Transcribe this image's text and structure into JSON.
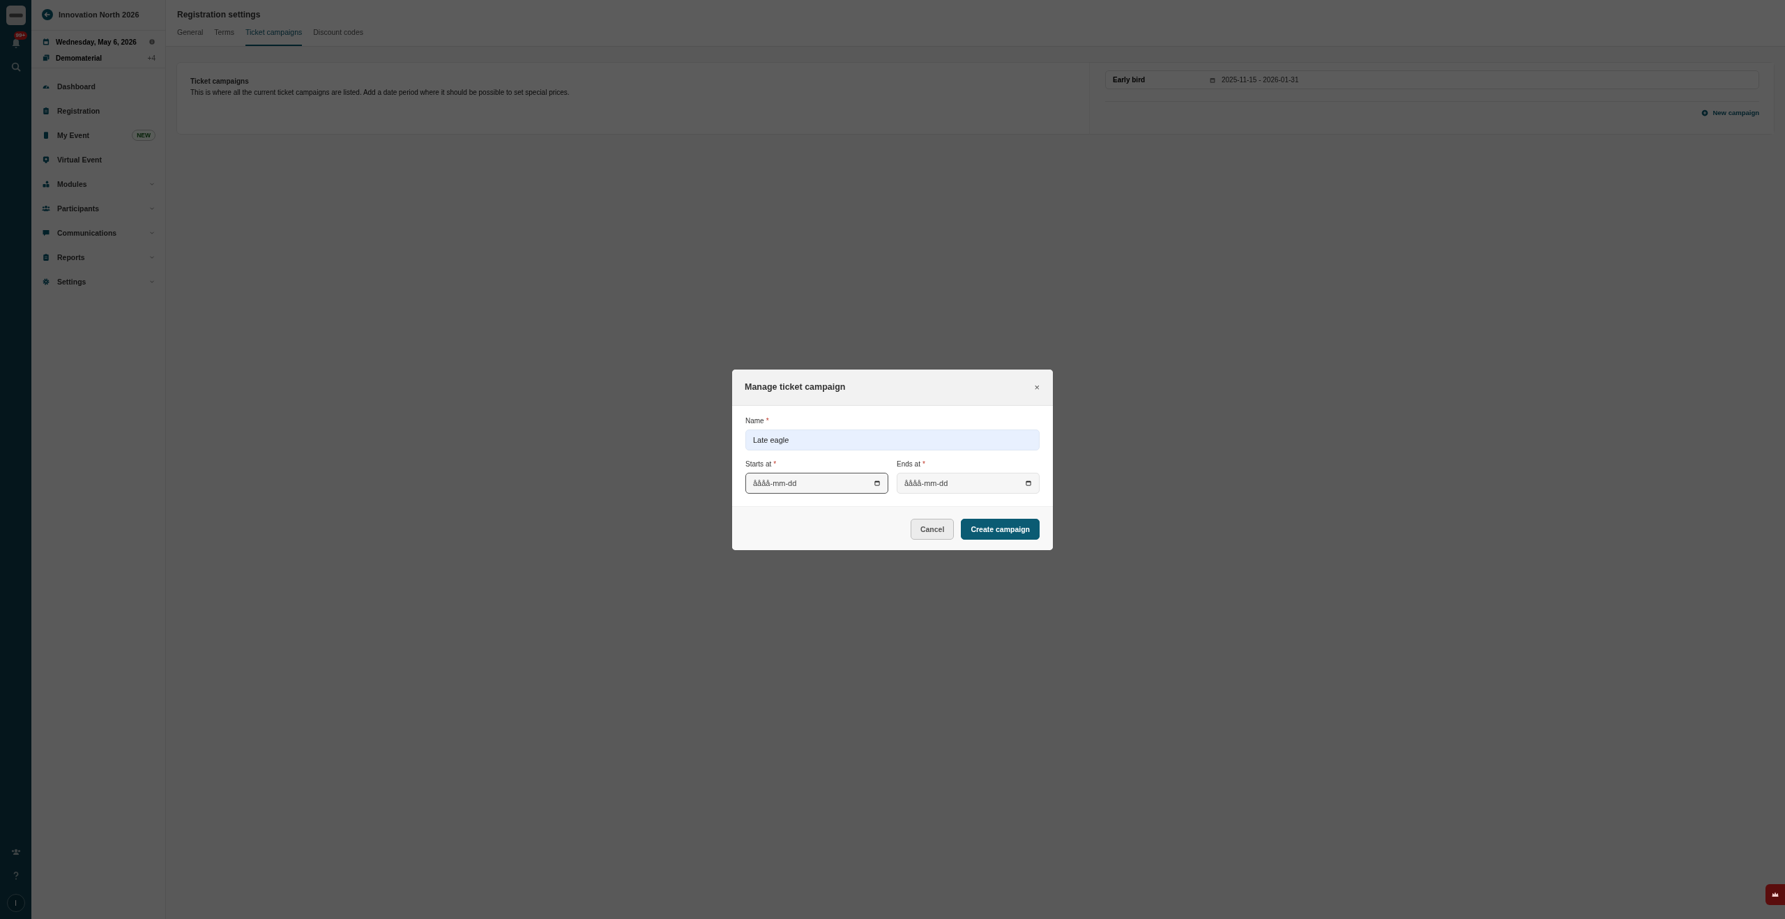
{
  "rail": {
    "notification_badge": "99+",
    "avatar_initial": "I"
  },
  "sidebar": {
    "event_title": "Innovation North 2026",
    "date": "Wednesday, May 6, 2026",
    "material": "Demomaterial",
    "material_count": "+4",
    "items": [
      {
        "label": "Dashboard",
        "kind": "link"
      },
      {
        "label": "Registration",
        "kind": "link"
      },
      {
        "label": "My Event",
        "kind": "link",
        "badge": "NEW"
      },
      {
        "label": "Virtual Event",
        "kind": "link"
      },
      {
        "label": "Modules",
        "kind": "group",
        "expanded": false
      },
      {
        "label": "Participants",
        "kind": "group",
        "expanded": false
      },
      {
        "label": "Communications",
        "kind": "group",
        "expanded": false
      },
      {
        "label": "Reports",
        "kind": "group",
        "expanded": false
      },
      {
        "label": "Settings",
        "kind": "group",
        "expanded": false
      }
    ]
  },
  "page": {
    "title": "Registration settings",
    "tabs": [
      {
        "label": "General",
        "selected": false
      },
      {
        "label": "Terms",
        "selected": false
      },
      {
        "label": "Ticket campaigns",
        "selected": true
      },
      {
        "label": "Discount codes",
        "selected": false
      }
    ]
  },
  "campaigns_section": {
    "title": "Ticket campaigns",
    "description": "This is where all the current ticket campaigns are listed. Add a date period where it should be possible to set special prices."
  },
  "campaigns": [
    {
      "name": "Early bird",
      "dates": "2025-11-15 - 2026-01-31"
    }
  ],
  "new_campaign_button": "New campaign",
  "dialog": {
    "title": "Manage ticket campaign",
    "close": "×",
    "required_mark": "*",
    "name_field": {
      "label": "Name",
      "required": true,
      "value": "Late eagle"
    },
    "date_fields": [
      {
        "label": "Starts at",
        "required": true,
        "placeholder": "åååå-mm-dd",
        "focused": true
      },
      {
        "label": "Ends at",
        "required": true,
        "placeholder": "åååå-mm-dd",
        "focused": false
      }
    ],
    "buttons": [
      {
        "label": "Cancel",
        "kind": "secondary"
      },
      {
        "label": "Create campaign",
        "kind": "primary"
      }
    ]
  }
}
